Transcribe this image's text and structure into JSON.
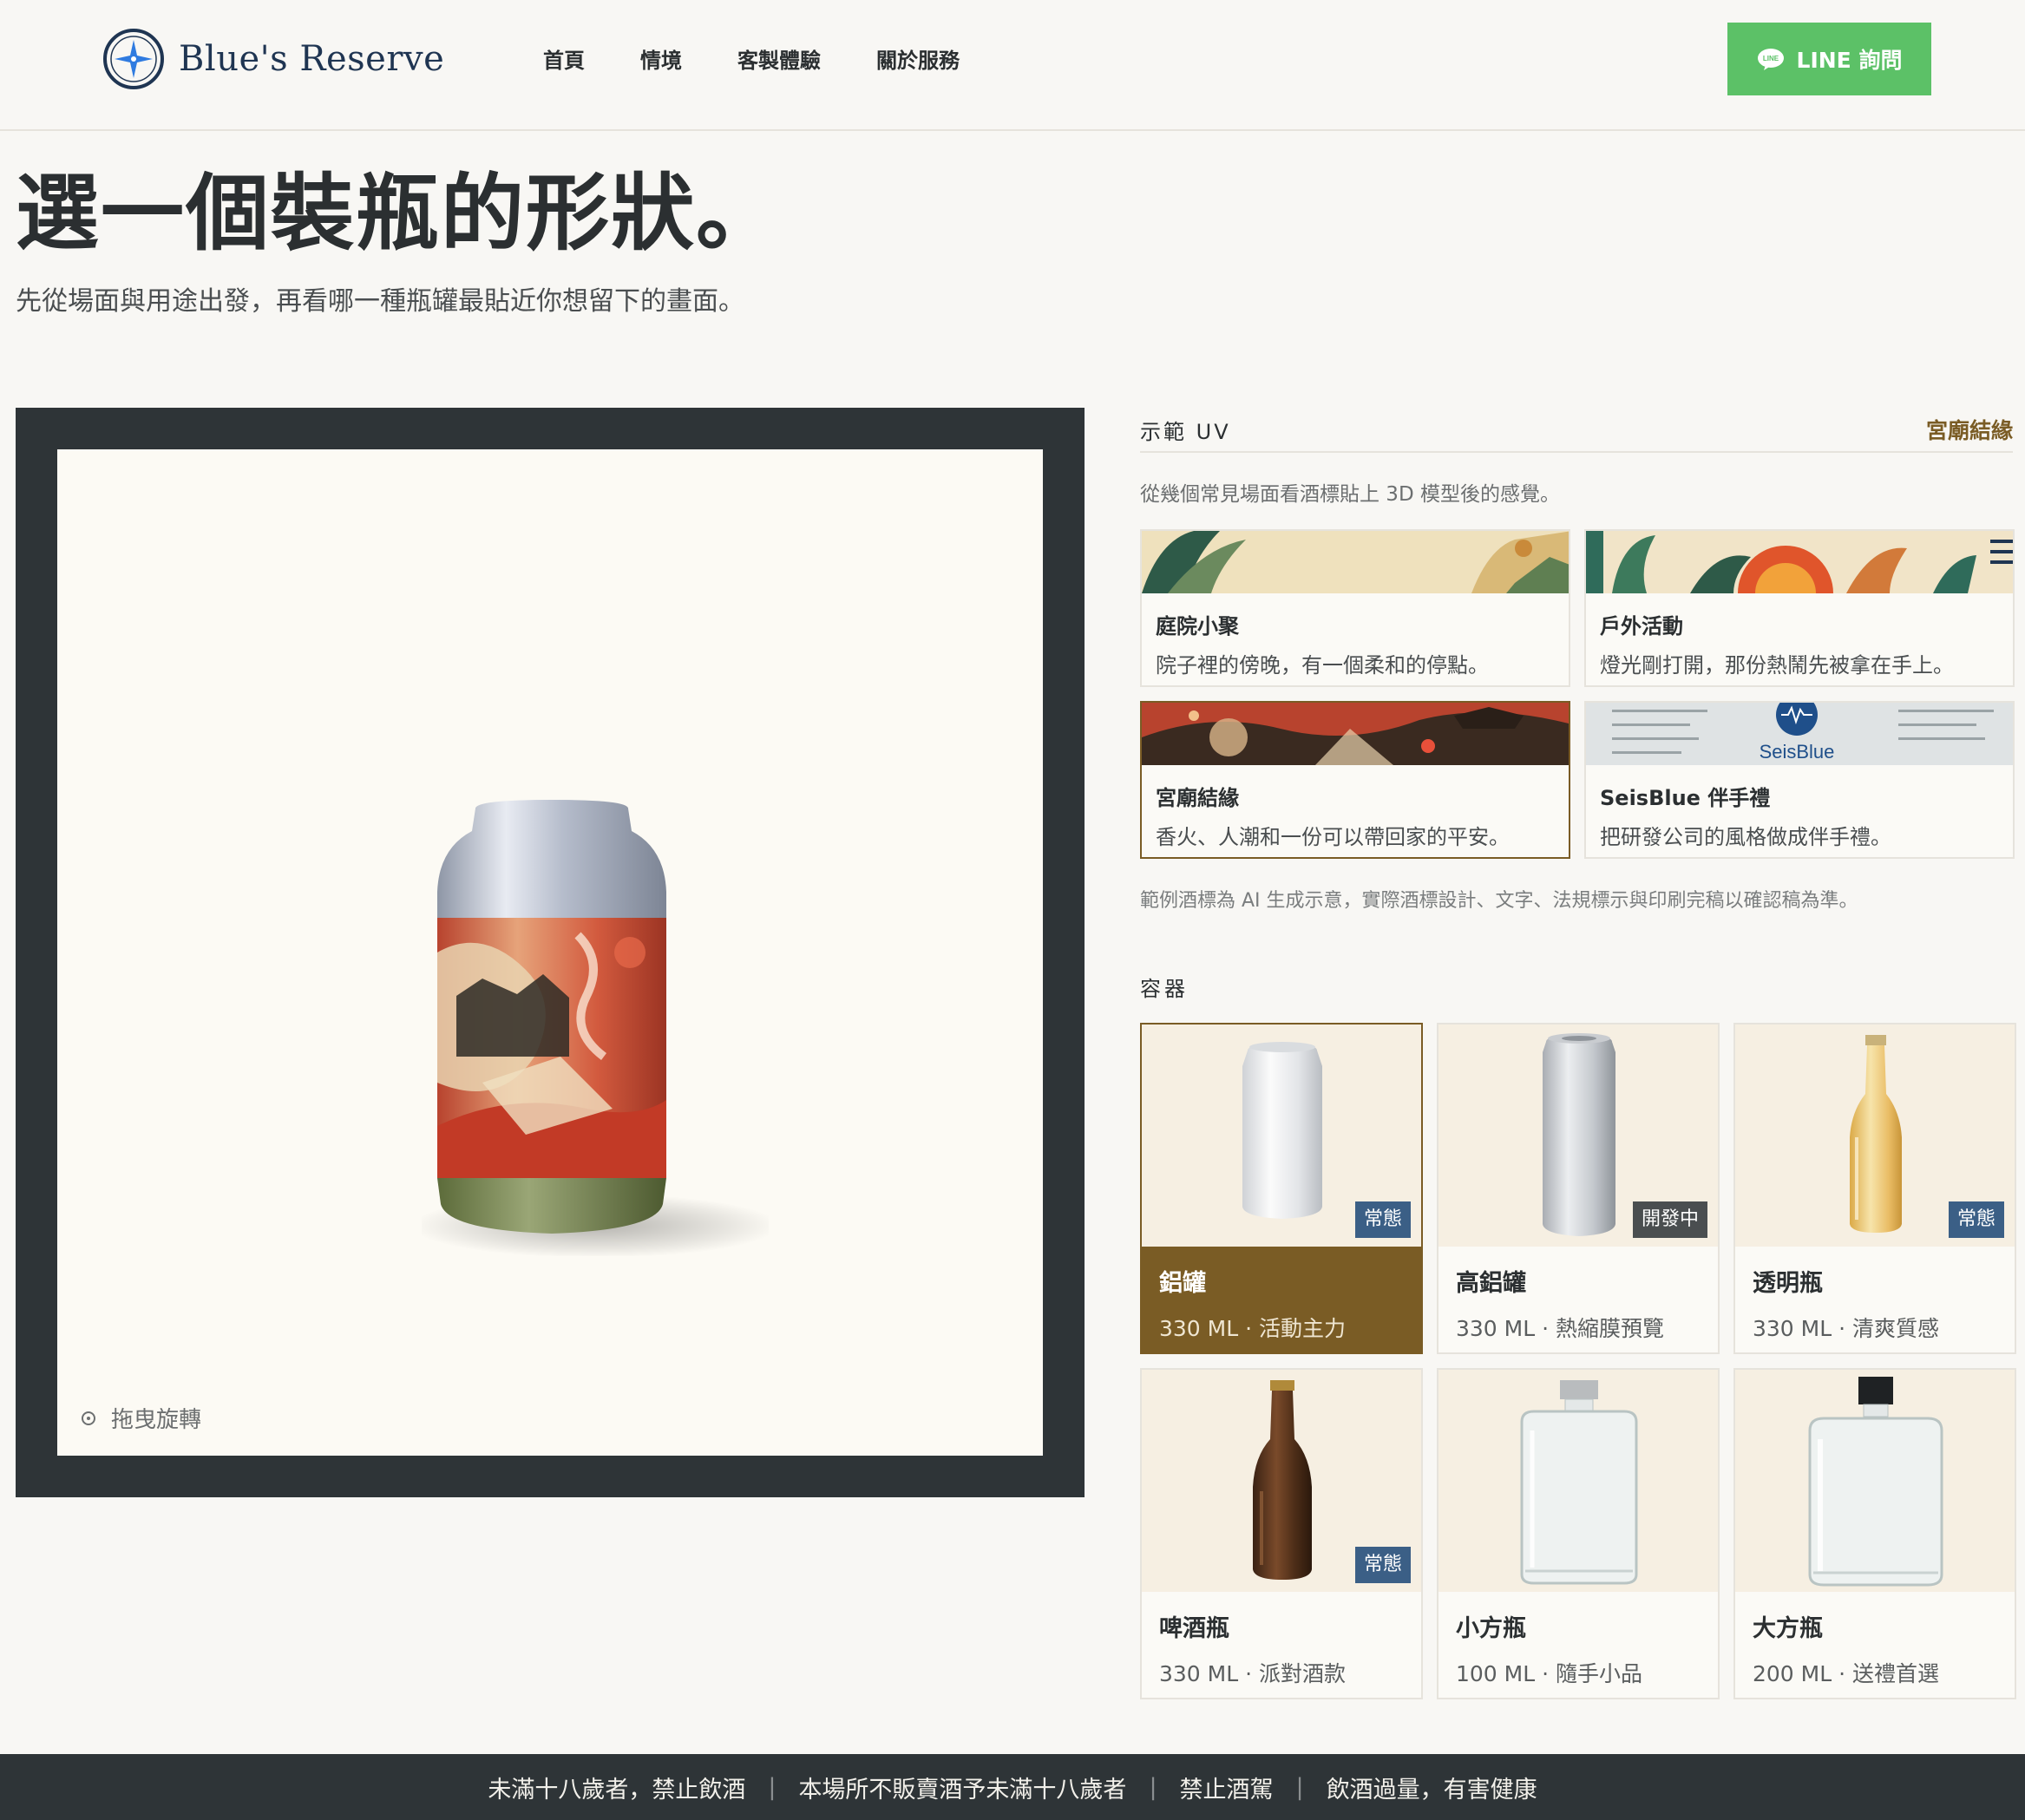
{
  "header": {
    "brand": "Blue's Reserve",
    "nav": [
      "首頁",
      "情境",
      "客製體驗",
      "關於服務"
    ],
    "line_button": "LINE 詢問"
  },
  "hero": {
    "title": "選一個裝瓶的形狀。",
    "subtitle": "先從場面與用途出發，再看哪一種瓶罐最貼近你想留下的畫面。"
  },
  "preview": {
    "drag_hint": "拖曳旋轉"
  },
  "uv": {
    "label": "示範 UV",
    "current": "宮廟結緣",
    "description": "從幾個常見場面看酒標貼上 3D 模型後的感覺。",
    "scenes": [
      {
        "title": "庭院小聚",
        "text": "院子裡的傍晚，有一個柔和的停點。",
        "active": false
      },
      {
        "title": "戶外活動",
        "text": "燈光剛打開，那份熱鬧先被拿在手上。",
        "active": false
      },
      {
        "title": "宮廟結緣",
        "text": "香火、人潮和一份可以帶回家的平安。",
        "active": true
      },
      {
        "title": "SeisBlue 伴手禮",
        "text": "把研發公司的風格做成伴手禮。",
        "active": false,
        "thumb_logo": "SeisBlue"
      }
    ],
    "disclaimer": "範例酒標為 AI 生成示意，實際酒標設計、文字、法規標示與印刷完稿以確認稿為準。"
  },
  "containers": {
    "label": "容器",
    "items": [
      {
        "name": "鋁罐",
        "meta": "330 ML · 活動主力",
        "badge": "常態",
        "active": true
      },
      {
        "name": "高鋁罐",
        "meta": "330 ML · 熱縮膜預覽",
        "badge": "開發中",
        "active": false
      },
      {
        "name": "透明瓶",
        "meta": "330 ML · 清爽質感",
        "badge": "常態",
        "active": false
      },
      {
        "name": "啤酒瓶",
        "meta": "330 ML · 派對酒款",
        "badge": "常態",
        "active": false
      },
      {
        "name": "小方瓶",
        "meta": "100 ML · 隨手小品",
        "badge": "",
        "active": false
      },
      {
        "name": "大方瓶",
        "meta": "200 ML · 送禮首選",
        "badge": "",
        "active": false
      }
    ]
  },
  "footer": {
    "warnings": [
      "未滿十八歲者，禁止飲酒",
      "本場所不販賣酒予未滿十八歲者",
      "禁止酒駕",
      "飲酒過量，有害健康"
    ]
  },
  "colors": {
    "accent": "#7a5c25",
    "line_green": "#5cc167",
    "dark": "#2e3437",
    "badge_blue": "#3b5f86"
  }
}
